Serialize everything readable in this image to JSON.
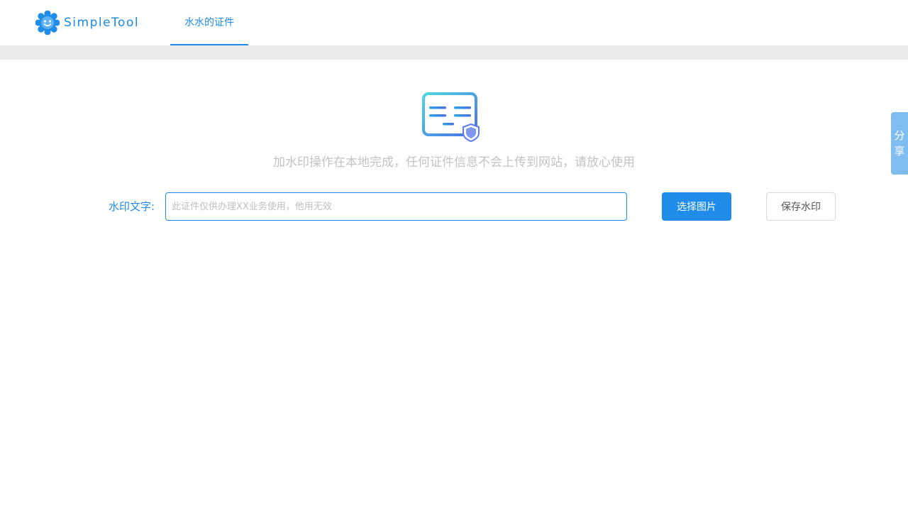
{
  "header": {
    "logo_text": "SimpleTool",
    "nav_tab_label": "水水的证件"
  },
  "main": {
    "notice": "加水印操作在本地完成，任何证件信息不会上传到网站，请放心使用",
    "watermark_label": "水印文字:",
    "watermark_input": {
      "value": "",
      "placeholder": "此证件仅供办理XX业务使用，他用无效"
    },
    "select_image_label": "选择图片",
    "save_watermark_label": "保存水印"
  },
  "share": {
    "char1": "分",
    "char2": "享"
  },
  "colors": {
    "accent": "#1e8ce8",
    "strip": "#ebebeb",
    "share_bg": "#7fbcf0"
  }
}
